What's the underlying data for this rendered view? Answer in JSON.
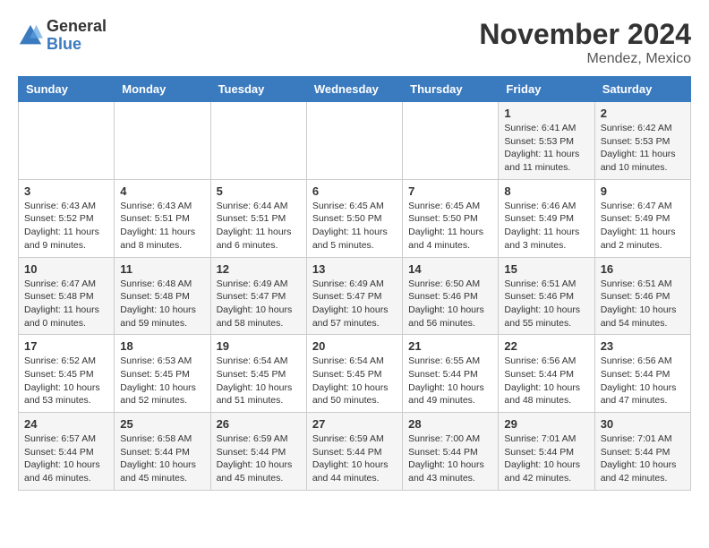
{
  "logo": {
    "general": "General",
    "blue": "Blue"
  },
  "header": {
    "month": "November 2024",
    "location": "Mendez, Mexico"
  },
  "weekdays": [
    "Sunday",
    "Monday",
    "Tuesday",
    "Wednesday",
    "Thursday",
    "Friday",
    "Saturday"
  ],
  "weeks": [
    [
      {
        "day": "",
        "info": ""
      },
      {
        "day": "",
        "info": ""
      },
      {
        "day": "",
        "info": ""
      },
      {
        "day": "",
        "info": ""
      },
      {
        "day": "",
        "info": ""
      },
      {
        "day": "1",
        "info": "Sunrise: 6:41 AM\nSunset: 5:53 PM\nDaylight: 11 hours and 11 minutes."
      },
      {
        "day": "2",
        "info": "Sunrise: 6:42 AM\nSunset: 5:53 PM\nDaylight: 11 hours and 10 minutes."
      }
    ],
    [
      {
        "day": "3",
        "info": "Sunrise: 6:43 AM\nSunset: 5:52 PM\nDaylight: 11 hours and 9 minutes."
      },
      {
        "day": "4",
        "info": "Sunrise: 6:43 AM\nSunset: 5:51 PM\nDaylight: 11 hours and 8 minutes."
      },
      {
        "day": "5",
        "info": "Sunrise: 6:44 AM\nSunset: 5:51 PM\nDaylight: 11 hours and 6 minutes."
      },
      {
        "day": "6",
        "info": "Sunrise: 6:45 AM\nSunset: 5:50 PM\nDaylight: 11 hours and 5 minutes."
      },
      {
        "day": "7",
        "info": "Sunrise: 6:45 AM\nSunset: 5:50 PM\nDaylight: 11 hours and 4 minutes."
      },
      {
        "day": "8",
        "info": "Sunrise: 6:46 AM\nSunset: 5:49 PM\nDaylight: 11 hours and 3 minutes."
      },
      {
        "day": "9",
        "info": "Sunrise: 6:47 AM\nSunset: 5:49 PM\nDaylight: 11 hours and 2 minutes."
      }
    ],
    [
      {
        "day": "10",
        "info": "Sunrise: 6:47 AM\nSunset: 5:48 PM\nDaylight: 11 hours and 0 minutes."
      },
      {
        "day": "11",
        "info": "Sunrise: 6:48 AM\nSunset: 5:48 PM\nDaylight: 10 hours and 59 minutes."
      },
      {
        "day": "12",
        "info": "Sunrise: 6:49 AM\nSunset: 5:47 PM\nDaylight: 10 hours and 58 minutes."
      },
      {
        "day": "13",
        "info": "Sunrise: 6:49 AM\nSunset: 5:47 PM\nDaylight: 10 hours and 57 minutes."
      },
      {
        "day": "14",
        "info": "Sunrise: 6:50 AM\nSunset: 5:46 PM\nDaylight: 10 hours and 56 minutes."
      },
      {
        "day": "15",
        "info": "Sunrise: 6:51 AM\nSunset: 5:46 PM\nDaylight: 10 hours and 55 minutes."
      },
      {
        "day": "16",
        "info": "Sunrise: 6:51 AM\nSunset: 5:46 PM\nDaylight: 10 hours and 54 minutes."
      }
    ],
    [
      {
        "day": "17",
        "info": "Sunrise: 6:52 AM\nSunset: 5:45 PM\nDaylight: 10 hours and 53 minutes."
      },
      {
        "day": "18",
        "info": "Sunrise: 6:53 AM\nSunset: 5:45 PM\nDaylight: 10 hours and 52 minutes."
      },
      {
        "day": "19",
        "info": "Sunrise: 6:54 AM\nSunset: 5:45 PM\nDaylight: 10 hours and 51 minutes."
      },
      {
        "day": "20",
        "info": "Sunrise: 6:54 AM\nSunset: 5:45 PM\nDaylight: 10 hours and 50 minutes."
      },
      {
        "day": "21",
        "info": "Sunrise: 6:55 AM\nSunset: 5:44 PM\nDaylight: 10 hours and 49 minutes."
      },
      {
        "day": "22",
        "info": "Sunrise: 6:56 AM\nSunset: 5:44 PM\nDaylight: 10 hours and 48 minutes."
      },
      {
        "day": "23",
        "info": "Sunrise: 6:56 AM\nSunset: 5:44 PM\nDaylight: 10 hours and 47 minutes."
      }
    ],
    [
      {
        "day": "24",
        "info": "Sunrise: 6:57 AM\nSunset: 5:44 PM\nDaylight: 10 hours and 46 minutes."
      },
      {
        "day": "25",
        "info": "Sunrise: 6:58 AM\nSunset: 5:44 PM\nDaylight: 10 hours and 45 minutes."
      },
      {
        "day": "26",
        "info": "Sunrise: 6:59 AM\nSunset: 5:44 PM\nDaylight: 10 hours and 45 minutes."
      },
      {
        "day": "27",
        "info": "Sunrise: 6:59 AM\nSunset: 5:44 PM\nDaylight: 10 hours and 44 minutes."
      },
      {
        "day": "28",
        "info": "Sunrise: 7:00 AM\nSunset: 5:44 PM\nDaylight: 10 hours and 43 minutes."
      },
      {
        "day": "29",
        "info": "Sunrise: 7:01 AM\nSunset: 5:44 PM\nDaylight: 10 hours and 42 minutes."
      },
      {
        "day": "30",
        "info": "Sunrise: 7:01 AM\nSunset: 5:44 PM\nDaylight: 10 hours and 42 minutes."
      }
    ]
  ]
}
